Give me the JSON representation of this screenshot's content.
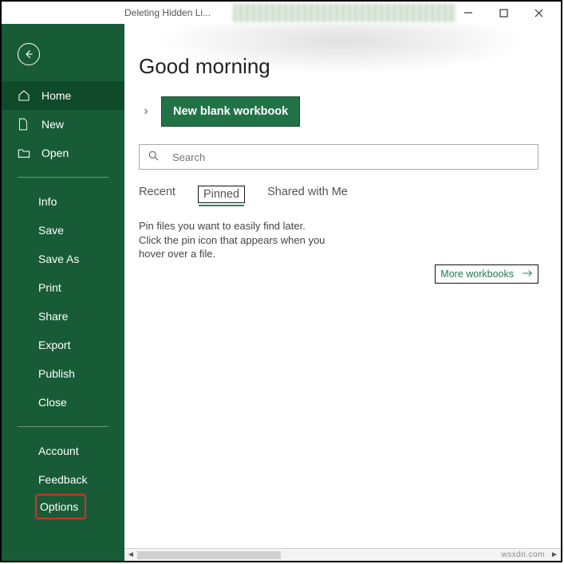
{
  "titlebar": {
    "title": "Deleting Hidden Li..."
  },
  "sidebar": {
    "home": "Home",
    "new": "New",
    "open": "Open",
    "items": [
      "Info",
      "Save",
      "Save As",
      "Print",
      "Share",
      "Export",
      "Publish",
      "Close"
    ],
    "account": "Account",
    "feedback": "Feedback",
    "options": "Options"
  },
  "main": {
    "greeting": "Good morning",
    "new_blank": "New blank workbook"
  },
  "search": {
    "placeholder": "Search"
  },
  "tabs": {
    "recent": "Recent",
    "pinned": "Pinned",
    "shared": "Shared with Me"
  },
  "pinned_hint": "Pin files you want to easily find later. Click the pin icon that appears when you hover over a file.",
  "more": "More workbooks",
  "watermark": "wsxdn.com"
}
